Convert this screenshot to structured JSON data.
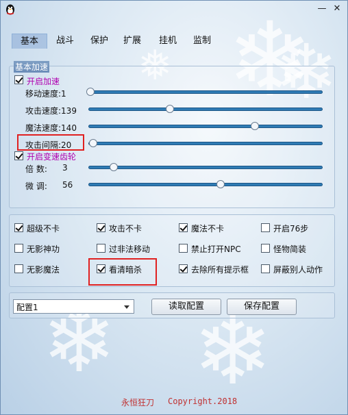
{
  "window": {
    "minimize_glyph": "—",
    "close_glyph": "✕",
    "title_icon": "penguin-icon"
  },
  "tabs": [
    {
      "label": "基本",
      "active": true
    },
    {
      "label": "战斗",
      "active": false
    },
    {
      "label": "保护",
      "active": false
    },
    {
      "label": "扩展",
      "active": false
    },
    {
      "label": "挂机",
      "active": false
    },
    {
      "label": "监制",
      "active": false
    }
  ],
  "basic_accel": {
    "group_title": "基本加速",
    "enable_label": "开启加速",
    "enable_checked": true,
    "sliders": [
      {
        "label": "移动速度:1",
        "value": 1,
        "max": 1000
      },
      {
        "label": "攻击速度:139",
        "value": 139,
        "max": 370
      },
      {
        "label": "魔法速度:140",
        "value": 140,
        "max": 190
      },
      {
        "label": "攻击间隔:20",
        "value": 20,
        "max": 1000
      }
    ],
    "gear_label": "开启变速齿轮",
    "gear_checked": true,
    "gear_sliders": [
      {
        "label": "倍   数:",
        "value_text": "3",
        "fraction": 0.1
      },
      {
        "label": "微   调:",
        "value_text": "56",
        "fraction": 0.56
      }
    ]
  },
  "options": [
    {
      "label": "超级不卡",
      "checked": true
    },
    {
      "label": "攻击不卡",
      "checked": true
    },
    {
      "label": "魔法不卡",
      "checked": true
    },
    {
      "label": "开启76步",
      "checked": false
    },
    {
      "label": "无影神功",
      "checked": false
    },
    {
      "label": "过非法移动",
      "checked": false
    },
    {
      "label": "禁止打开NPC",
      "checked": false
    },
    {
      "label": "怪物简装",
      "checked": false
    },
    {
      "label": "无影魔法",
      "checked": false
    },
    {
      "label": "看清暗杀",
      "checked": true
    },
    {
      "label": "去除所有提示框",
      "checked": true
    },
    {
      "label": "屏蔽别人动作",
      "checked": false
    }
  ],
  "config": {
    "selected": "配置1",
    "read_label": "读取配置",
    "save_label": "保存配置"
  },
  "footer": {
    "name": "永恒狂刀",
    "copyright": "Copyright.2018"
  },
  "colors": {
    "accent_magenta": "#b000b0",
    "highlight_red": "#e02020",
    "slider_blue": "#2f7bb4",
    "footer_red": "#c03030"
  }
}
